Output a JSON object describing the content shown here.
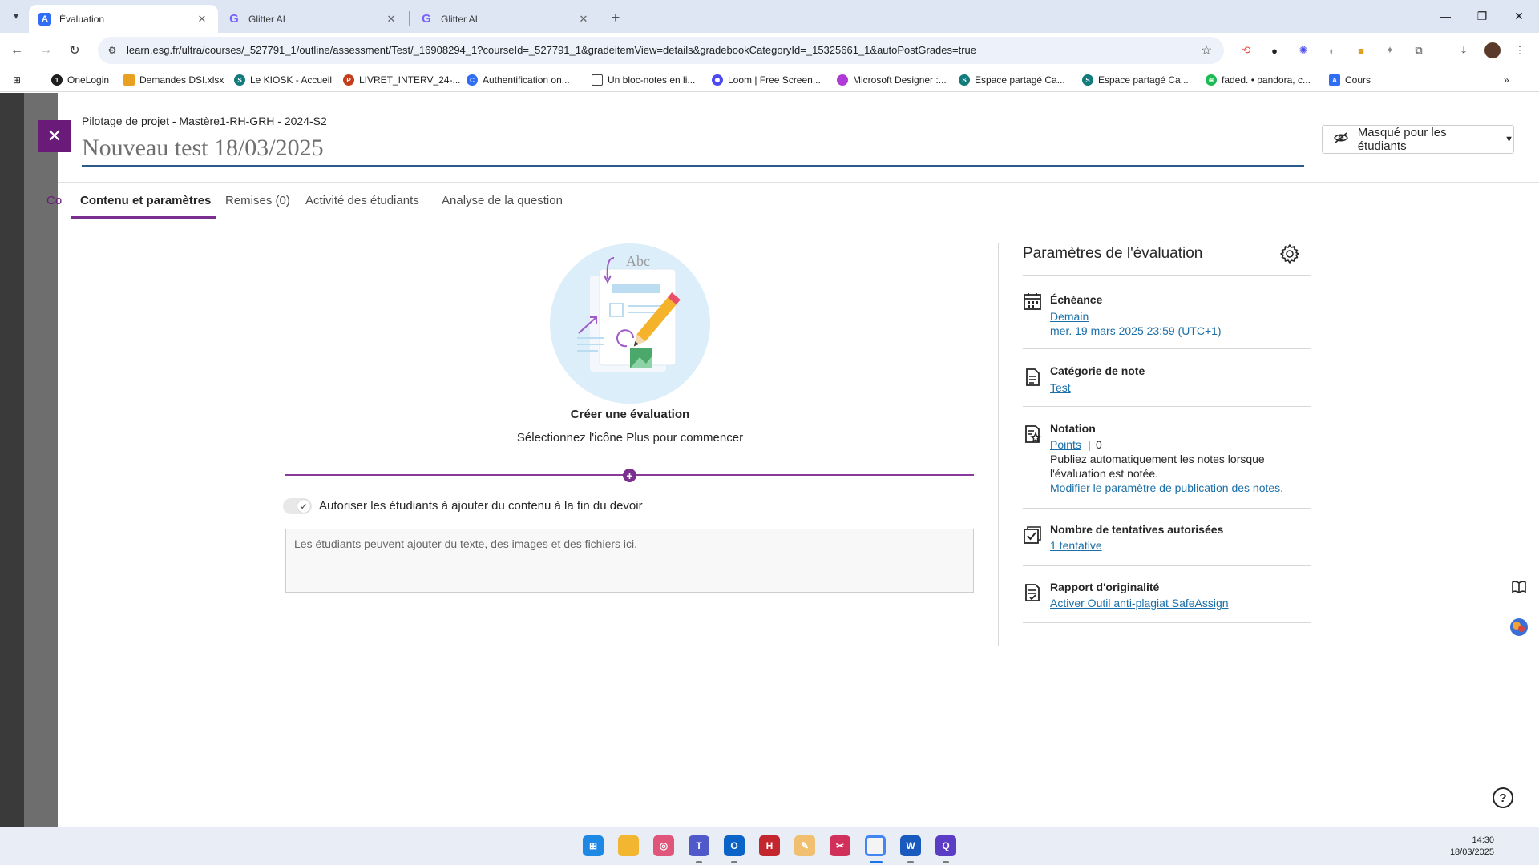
{
  "browser": {
    "tabs": [
      {
        "title": "Évaluation",
        "active": true
      },
      {
        "title": "Glitter AI",
        "active": false
      },
      {
        "title": "Glitter AI",
        "active": false
      }
    ],
    "url": "learn.esg.fr/ultra/courses/_527791_1/outline/assessment/Test/_16908294_1?courseId=_527791_1&gradeitemView=details&gradebookCategoryId=_15325661_1&autoPostGrades=true",
    "bookmarks": [
      "OneLogin",
      "Demandes DSI.xlsx",
      "Le KIOSK - Accueil",
      "LIVRET_INTERV_24-...",
      "Authentification on...",
      "Un bloc-notes en li...",
      "Loom | Free Screen...",
      "Microsoft Designer :...",
      "Espace partagé Ca...",
      "Espace partagé Ca...",
      "faded. • pandora, c...",
      "Cours"
    ]
  },
  "page": {
    "breadcrumb": "Pilotage de projet - Mastère1-RH-GRH - 2024-S2",
    "title": "Nouveau test 18/03/2025",
    "visibility": "Masqué pour les étudiants",
    "background_tab_hint": "Co",
    "tabs": [
      {
        "label": "Contenu et paramètres",
        "active": true
      },
      {
        "label": "Remises (0)",
        "active": false
      },
      {
        "label": "Activité des étudiants",
        "active": false
      },
      {
        "label": "Analyse de la question",
        "active": false
      }
    ]
  },
  "content": {
    "illustration_text": "Abc",
    "create_title": "Créer une évaluation",
    "create_subtitle": "Sélectionnez l'icône Plus pour commencer",
    "toggle_label": "Autoriser les étudiants à ajouter du contenu à la fin du devoir",
    "toggle_on": true,
    "textarea_placeholder": "Les étudiants peuvent ajouter du texte, des images et des fichiers ici."
  },
  "settings": {
    "title": "Paramètres de l'évaluation",
    "due": {
      "label": "Échéance",
      "relative": "Demain",
      "date": "mer. 19 mars 2025 23:59 (UTC+1)"
    },
    "category": {
      "label": "Catégorie de note",
      "value": "Test"
    },
    "grading": {
      "label": "Notation",
      "type": "Points",
      "separator": "|",
      "max": "0",
      "publish_text_1": "Publiez automatiquement les notes lorsque",
      "publish_text_2": "l'évaluation est notée.",
      "publish_link": "Modifier le paramètre de publication des notes."
    },
    "attempts": {
      "label": "Nombre de tentatives autorisées",
      "value": "1 tentative"
    },
    "originality": {
      "label": "Rapport d'originalité",
      "value": "Activer Outil anti-plagiat SafeAssign"
    }
  },
  "taskbar": {
    "time": "14:30",
    "date": "18/03/2025"
  },
  "colors": {
    "accent": "#7b2f8e",
    "link": "#1a6fa8",
    "title_underline": "#2a5a8a"
  }
}
